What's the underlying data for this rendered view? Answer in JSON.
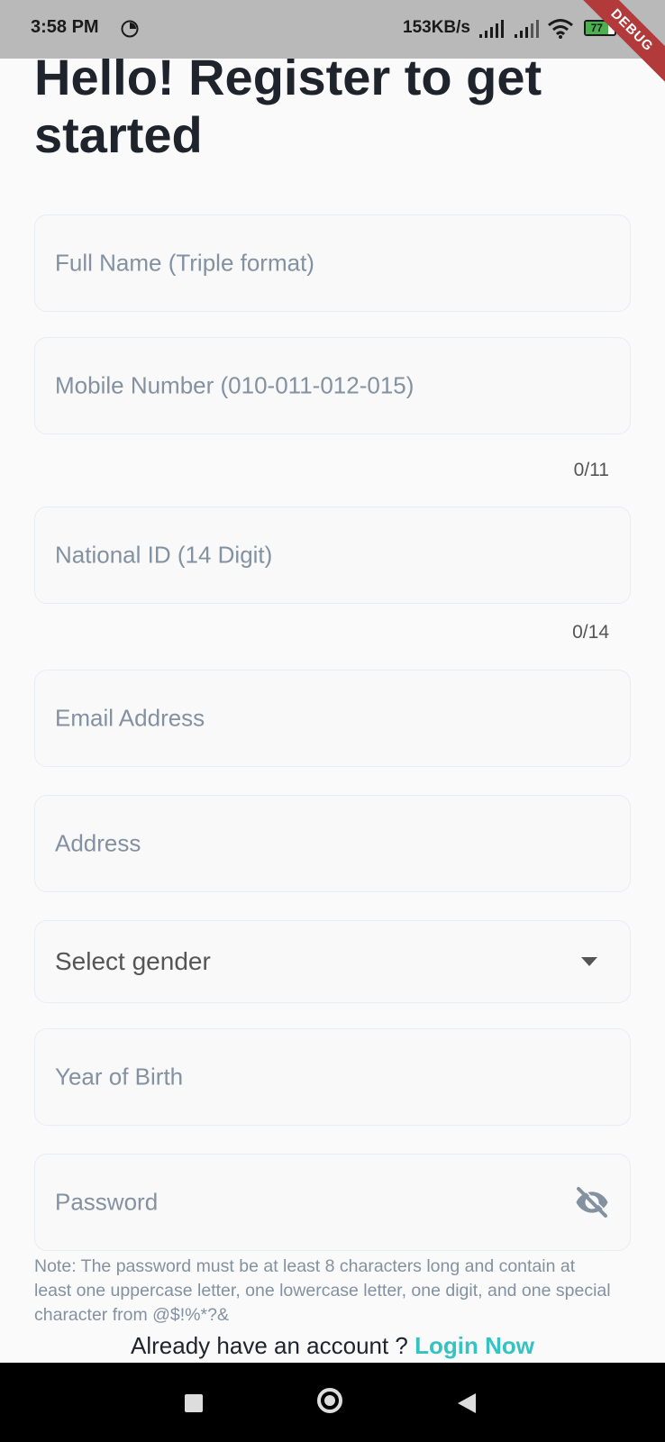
{
  "status_bar": {
    "time": "3:58 PM",
    "network_speed": "153KB/s",
    "battery": "77",
    "debug_banner": "DEBUG"
  },
  "title": "Hello! Register to get started",
  "fields": {
    "full_name": "Full Name (Triple format)",
    "mobile": "Mobile Number (010-011-012-015)",
    "mobile_counter": "0/11",
    "national_id": "National ID (14 Digit)",
    "national_id_counter": "0/14",
    "email": "Email Address",
    "address": "Address",
    "gender": "Select gender",
    "year_of_birth": "Year of Birth",
    "password": "Password"
  },
  "password_note": "Note: The password must be at least 8 characters long and contain at least one uppercase letter, one lowercase letter, one digit, and one special character from @$!%*?&",
  "login_prompt": "Already have an account ?",
  "login_link": "Login Now",
  "icons": {
    "dropdown": "chevron-down-icon",
    "password_visibility": "eye-off-icon"
  },
  "colors": {
    "accent": "#35c2c1",
    "title": "#1e232c",
    "placeholder": "#8391a1"
  }
}
